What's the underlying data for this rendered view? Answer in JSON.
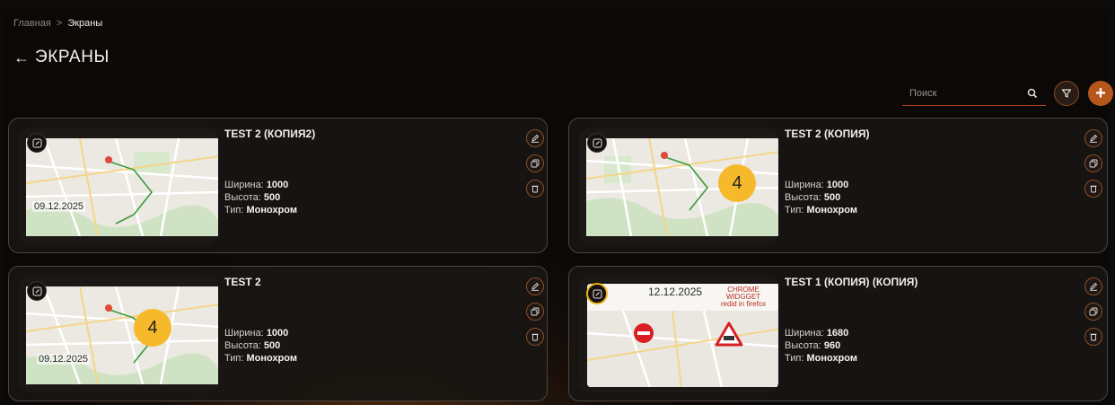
{
  "breadcrumb": {
    "home": "Главная",
    "separator": ">",
    "current": "Экраны"
  },
  "page": {
    "back_icon": "arrow-left-icon",
    "title": "ЭКРАНЫ"
  },
  "search": {
    "placeholder": "Поиск",
    "icon": "search-icon"
  },
  "toolbar": {
    "filter_icon": "filter-icon",
    "add_icon": "plus-icon",
    "add_label": "+"
  },
  "accent_colors": {
    "primary": "#b6581c",
    "badge": "#f6b92c",
    "border": "#8a4e27"
  },
  "labels": {
    "width": "Ширина:",
    "height": "Высота:",
    "type": "Тип:"
  },
  "screens": [
    {
      "title": "TEST 2 (КОПИЯ2)",
      "width": "1000",
      "height": "500",
      "type": "Монохром",
      "preview_date": "09.12.2025",
      "preview_badge": ""
    },
    {
      "title": "TEST 2 (КОПИЯ)",
      "width": "1000",
      "height": "500",
      "type": "Монохром",
      "preview_date": "",
      "preview_badge": "4"
    },
    {
      "title": "TEST 2",
      "width": "1000",
      "height": "500",
      "type": "Монохром",
      "preview_date": "09.12.2025",
      "preview_badge": "4"
    },
    {
      "title": "TEST 1 (КОПИЯ) (КОПИЯ)",
      "width": "1680",
      "height": "960",
      "type": "Монохром",
      "preview_date": "12.12.2025",
      "preview_badge": "",
      "preview_note": [
        "CHROME",
        "WIDGGET",
        "redid in firefox"
      ]
    }
  ],
  "card_actions": [
    "pencil-icon",
    "copy-icon",
    "trash-icon"
  ]
}
